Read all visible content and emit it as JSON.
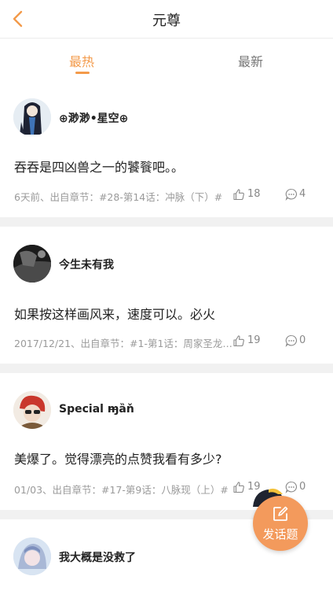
{
  "header": {
    "title": "元尊",
    "back_icon": "chevron-left-icon",
    "accent": "#f39a4a"
  },
  "tabs": [
    {
      "label": "最热",
      "active": true
    },
    {
      "label": "最新",
      "active": false
    }
  ],
  "posts": [
    {
      "username": "⊕渺渺•星空⊕",
      "content": "吞吞是四凶兽之一的饕餮吧。。",
      "meta": "6天前、出自章节：#28-第14话：冲脉（下）#",
      "likes": "18",
      "comments": "4"
    },
    {
      "username": "今生未有我",
      "content": "如果按这样画风来，速度可以。必火",
      "meta": "2017/12/21、出自章节：#1-第1话：周家圣龙…",
      "likes": "19",
      "comments": "0"
    },
    {
      "username": "Special ɱ̶ȁň",
      "content": "美爆了。觉得漂亮的点赞我看有多少?",
      "meta": "01/03、出自章节：#17-第9话：八脉现（上）#",
      "likes": "19",
      "comments": "0"
    },
    {
      "username": "我大概是没救了"
    }
  ],
  "fab": {
    "label": "发话题",
    "icon": "edit-icon"
  }
}
